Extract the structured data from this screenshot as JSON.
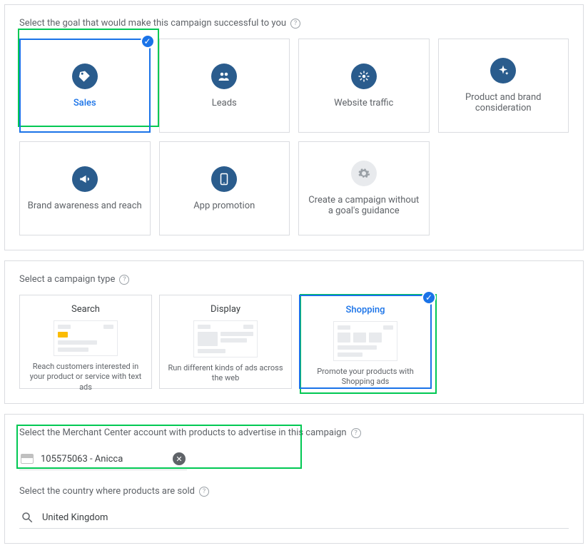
{
  "goals": {
    "label": "Select the goal that would make this campaign successful to you",
    "items": [
      {
        "label": "Sales",
        "icon": "tag-icon",
        "selected": true
      },
      {
        "label": "Leads",
        "icon": "people-icon",
        "selected": false
      },
      {
        "label": "Website traffic",
        "icon": "click-icon",
        "selected": false
      },
      {
        "label": "Product and brand consideration",
        "icon": "sparkle-icon",
        "selected": false
      },
      {
        "label": "Brand awareness and reach",
        "icon": "megaphone-icon",
        "selected": false
      },
      {
        "label": "App promotion",
        "icon": "phone-icon",
        "selected": false
      },
      {
        "label": "Create a campaign without a goal's guidance",
        "icon": "gear-icon",
        "selected": false
      }
    ]
  },
  "campaign_type": {
    "label": "Select a campaign type",
    "items": [
      {
        "title": "Search",
        "desc": "Reach customers interested in your product or service with text ads",
        "selected": false
      },
      {
        "title": "Display",
        "desc": "Run different kinds of ads across the web",
        "selected": false
      },
      {
        "title": "Shopping",
        "desc": "Promote your products with Shopping ads",
        "selected": true
      }
    ]
  },
  "merchant": {
    "label": "Select the Merchant Center account with products to advertise in this campaign",
    "value": "105575063 - Anicca"
  },
  "country": {
    "label": "Select the country where products are sold",
    "value": "United Kingdom"
  }
}
